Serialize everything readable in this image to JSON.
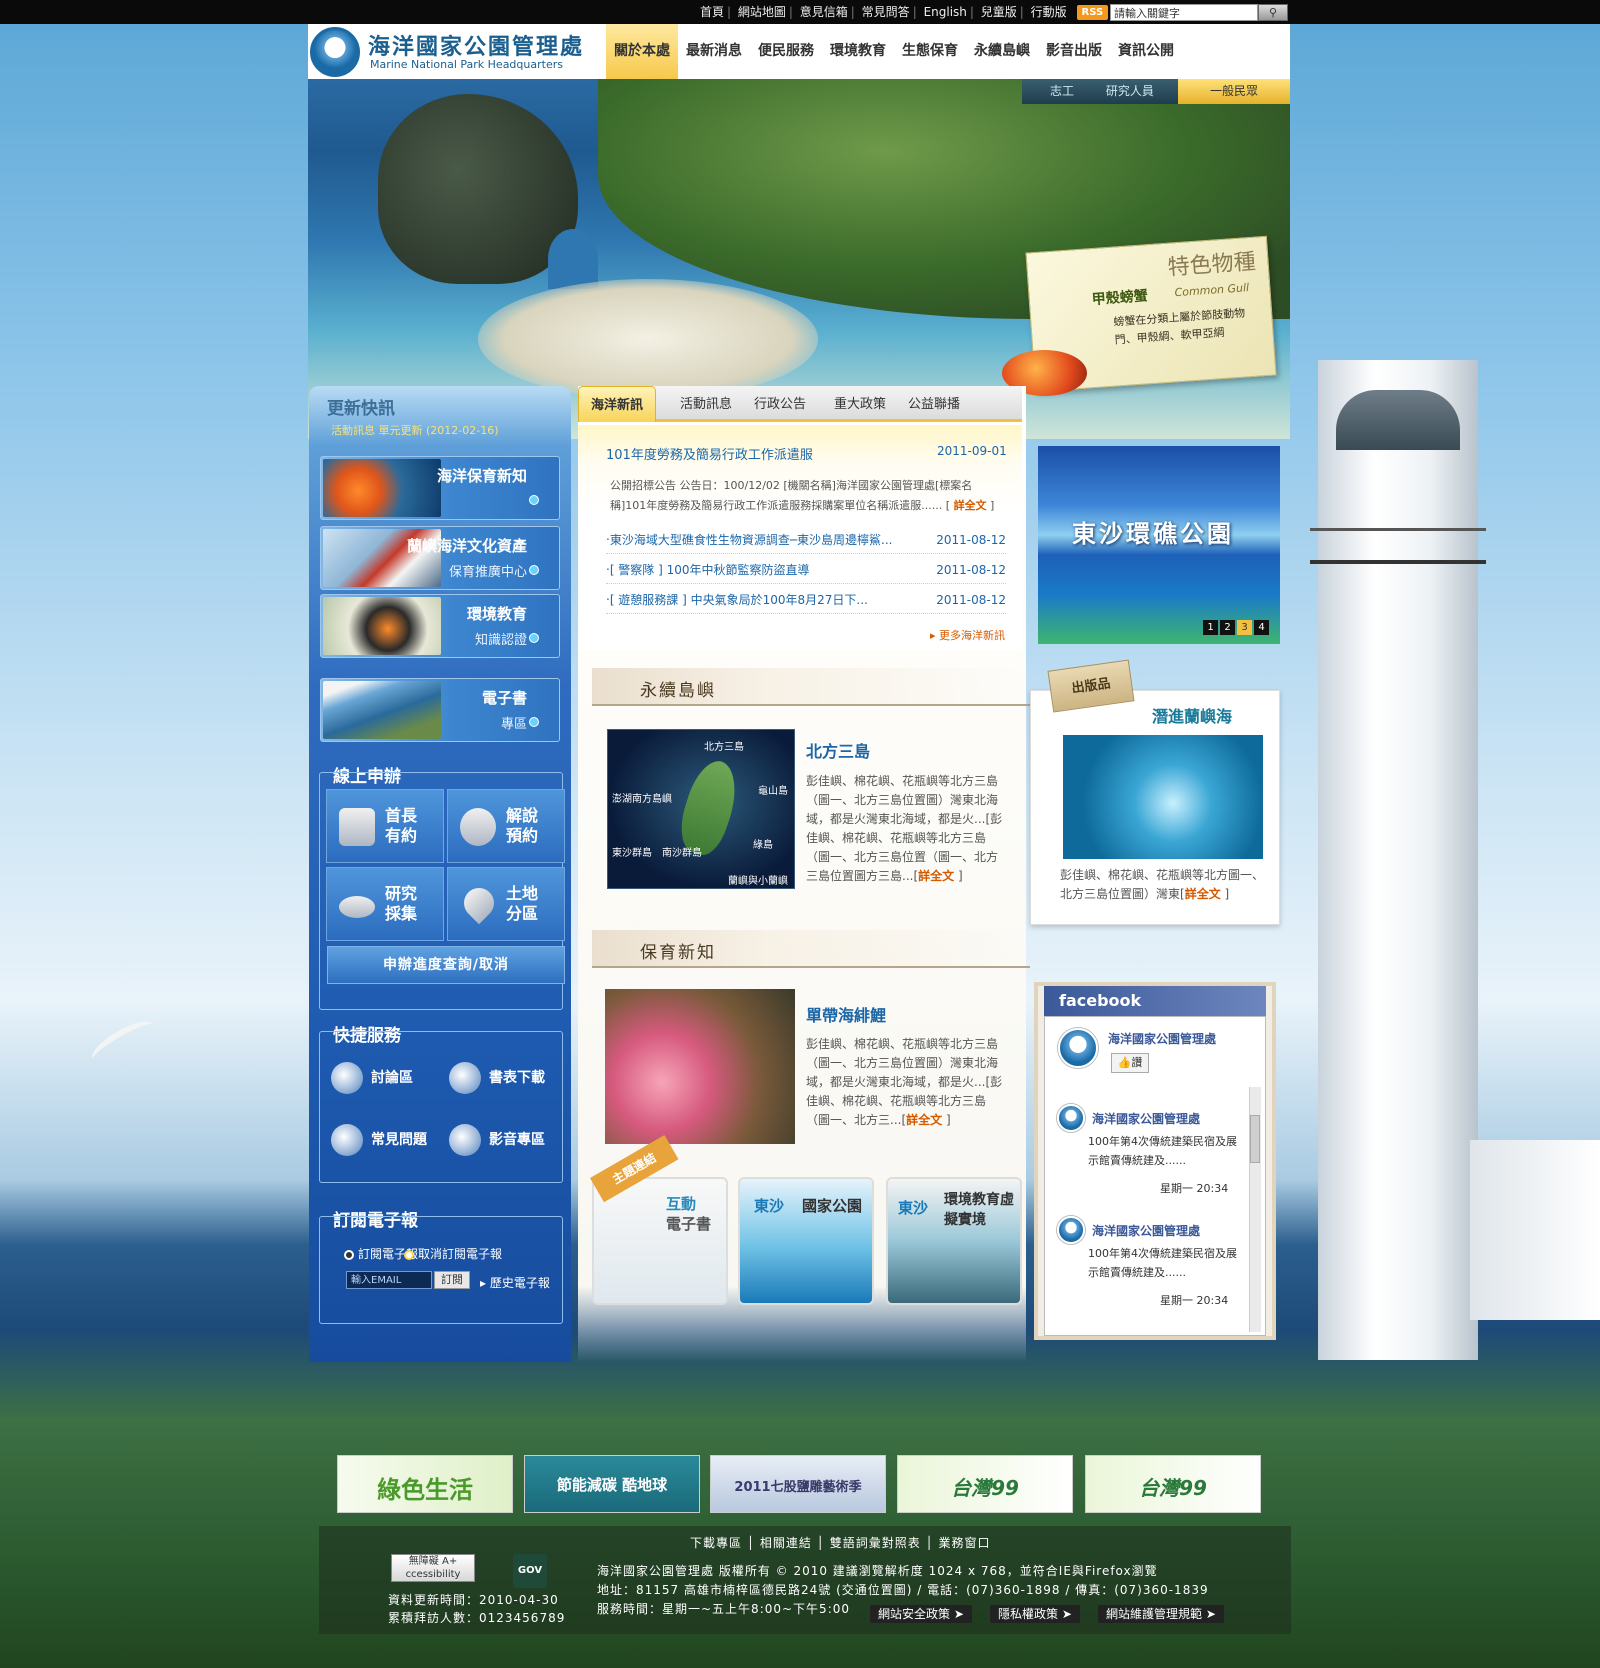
{
  "topbar": {
    "links": [
      "首頁",
      "網站地圖",
      "意見信箱",
      "常見問答",
      "English",
      "兒童版",
      "行動版"
    ],
    "rss": "RSS",
    "search_placeholder": "請輸入關鍵字"
  },
  "header": {
    "logo_cn": "海洋國家公園管理處",
    "logo_en": "Marine National Park Headquarters",
    "nav": [
      "關於本處",
      "最新消息",
      "便民服務",
      "環境教育",
      "生態保育",
      "永續島嶼",
      "影音出版",
      "資訊公開"
    ],
    "active_nav": "關於本處"
  },
  "roles": [
    "志工",
    "研究人員",
    "一般民眾"
  ],
  "species": {
    "title": "特色物種",
    "name": "甲殼螃蟹",
    "en_name": "Common Gull",
    "desc": "螃蟹在分類上屬於節肢動物門、甲殼綱、軟甲亞綱"
  },
  "newsflash": {
    "title": "更新快訊",
    "item": "活動訊息 單元更新 (2012-02-16)"
  },
  "left_banners": [
    {
      "title": "海洋保育新知",
      "sub": ""
    },
    {
      "title": "蘭嶼海洋文化資產",
      "sub": "保育推廣中心"
    },
    {
      "title": "環境教育",
      "sub": "知識認證"
    },
    {
      "title": "電子書",
      "sub": "專區"
    }
  ],
  "apply": {
    "title": "線上申辦",
    "buttons": [
      {
        "l1": "首長",
        "l2": "有約"
      },
      {
        "l1": "解說",
        "l2": "預約"
      },
      {
        "l1": "研究",
        "l2": "採集"
      },
      {
        "l1": "土地",
        "l2": "分區"
      }
    ],
    "progress": "申辦進度查詢/取消"
  },
  "quick": {
    "title": "快捷服務",
    "items": [
      "討論區",
      "書表下載",
      "常見問題",
      "影音專區"
    ]
  },
  "epaper": {
    "title": "訂閱電子報",
    "subscribe": "訂閱電子報",
    "unsubscribe": "取消訂閱電子報",
    "email_placeholder": "輸入EMAIL",
    "submit": "訂閱",
    "history": "歷史電子報"
  },
  "tabs": [
    "海洋新訊",
    "活動訊息",
    "行政公告",
    "重大政策",
    "公益聯播"
  ],
  "active_tab": "海洋新訊",
  "news": {
    "top_title": "101年度勞務及簡易行政工作派遣服",
    "top_date": "2011-09-01",
    "top_body": "公開招標公告 公告日：100/12/02 [機關名稱]海洋國家公園管理處[標案名稱]101年度勞務及簡易行政工作派遣服務採購案單位名稱派遣服......",
    "more_link": "詳全文",
    "items": [
      {
        "title": "‧東沙海域大型礁食性生物資源調查─東沙島周邊檸鯊...",
        "date": "2011-08-12"
      },
      {
        "title": "‧[ 警察隊 ] 100年中秋節監察防盜直導",
        "date": "2011-08-12"
      },
      {
        "title": "‧[ 遊憩服務課 ] 中央氣象局於100年8月27日下...",
        "date": "2011-08-12"
      }
    ],
    "more_news": "更多海洋新訊"
  },
  "islands": {
    "section": "永續島嶼",
    "title": "北方三島",
    "body": "彭佳嶼、棉花嶼、花瓶嶼等北方三島（圖一、北方三島位置圖）灣東北海域，都是火灣東北海域，都是火...[彭佳嶼、棉花嶼、花瓶嶼等北方三島（圖一、北方三島位置（圖一、北方三島位置圖方三島...",
    "more": "詳全文",
    "map_labels": [
      "北方三島",
      "龜山島",
      "澎湖南方島嶼",
      "綠島",
      "東沙群島",
      "南沙群島",
      "蘭嶼與小蘭嶼"
    ]
  },
  "conservation": {
    "section": "保育新知",
    "title": "單帶海緋鯉",
    "body": "彭佳嶼、棉花嶼、花瓶嶼等北方三島（圖一、北方三島位置圖）灣東北海域，都是火灣東北海域，都是火...[彭佳嶼、棉花嶼、花瓶嶼等北方三島（圖一、北方三...",
    "more": "詳全文"
  },
  "carousel": {
    "title": "東沙環礁公園",
    "pages": [
      "1",
      "2",
      "3",
      "4"
    ],
    "active_page": "3"
  },
  "publication": {
    "tag": "出版品",
    "title": "潛進蘭嶼海",
    "body": "彭佳嶼、棉花嶼、花瓶嶼等北方圖一、北方三島位置圖）灣東",
    "more": "詳全文"
  },
  "themes": {
    "tag": "主題連結",
    "items": [
      {
        "a": "互動",
        "b": "電子書"
      },
      {
        "a": "東沙",
        "b": "國家公園"
      },
      {
        "a": "東沙",
        "b": "環境教育虛擬實境"
      }
    ]
  },
  "facebook": {
    "brand": "facebook",
    "page_name": "海洋國家公園管理處",
    "like": "讚",
    "posts": [
      {
        "name": "海洋國家公園管理處",
        "text": "100年第4次傳統建築民宿及展示館賣傳統建及......",
        "time": "星期一 20:34"
      },
      {
        "name": "海洋國家公園管理處",
        "text": "100年第4次傳統建築民宿及展示館賣傳統建及......",
        "time": "星期一 20:34"
      }
    ]
  },
  "partners": [
    "綠色生活",
    "節能減碳 酷地球",
    "2011七股鹽雕藝術季",
    "台灣99",
    "台灣99"
  ],
  "footer": {
    "links": "下載專區 │ 相關連結 │ 雙語詞彙對照表 │ 業務窗口",
    "badge": "無障礙 A+ ccessibility",
    "gov": "GOV",
    "update": "資料更新時間：2010-04-30",
    "visitors": "累積拜訪人數：0123456789",
    "copy1": "海洋國家公園管理處 版權所有 © 2010    建議瀏覽解析度 1024 x 768，並符合IE與Firefox瀏覽",
    "copy2": "地址：81157 高雄市楠梓區德民路24號 (交通位置圖)  /  電話：(07)360-1898  /  傳真：(07)360-1839",
    "copy3": "服務時間：星期一~五上午8:00~下午5:00",
    "buttons": [
      "網站安全政策",
      "隱私權政策",
      "網站維護管理規範"
    ]
  },
  "colors": {
    "accent": "#f2c040",
    "link": "#1c66a8",
    "nav_active": "#f6c94b",
    "left_panel": "#1c58ad"
  }
}
